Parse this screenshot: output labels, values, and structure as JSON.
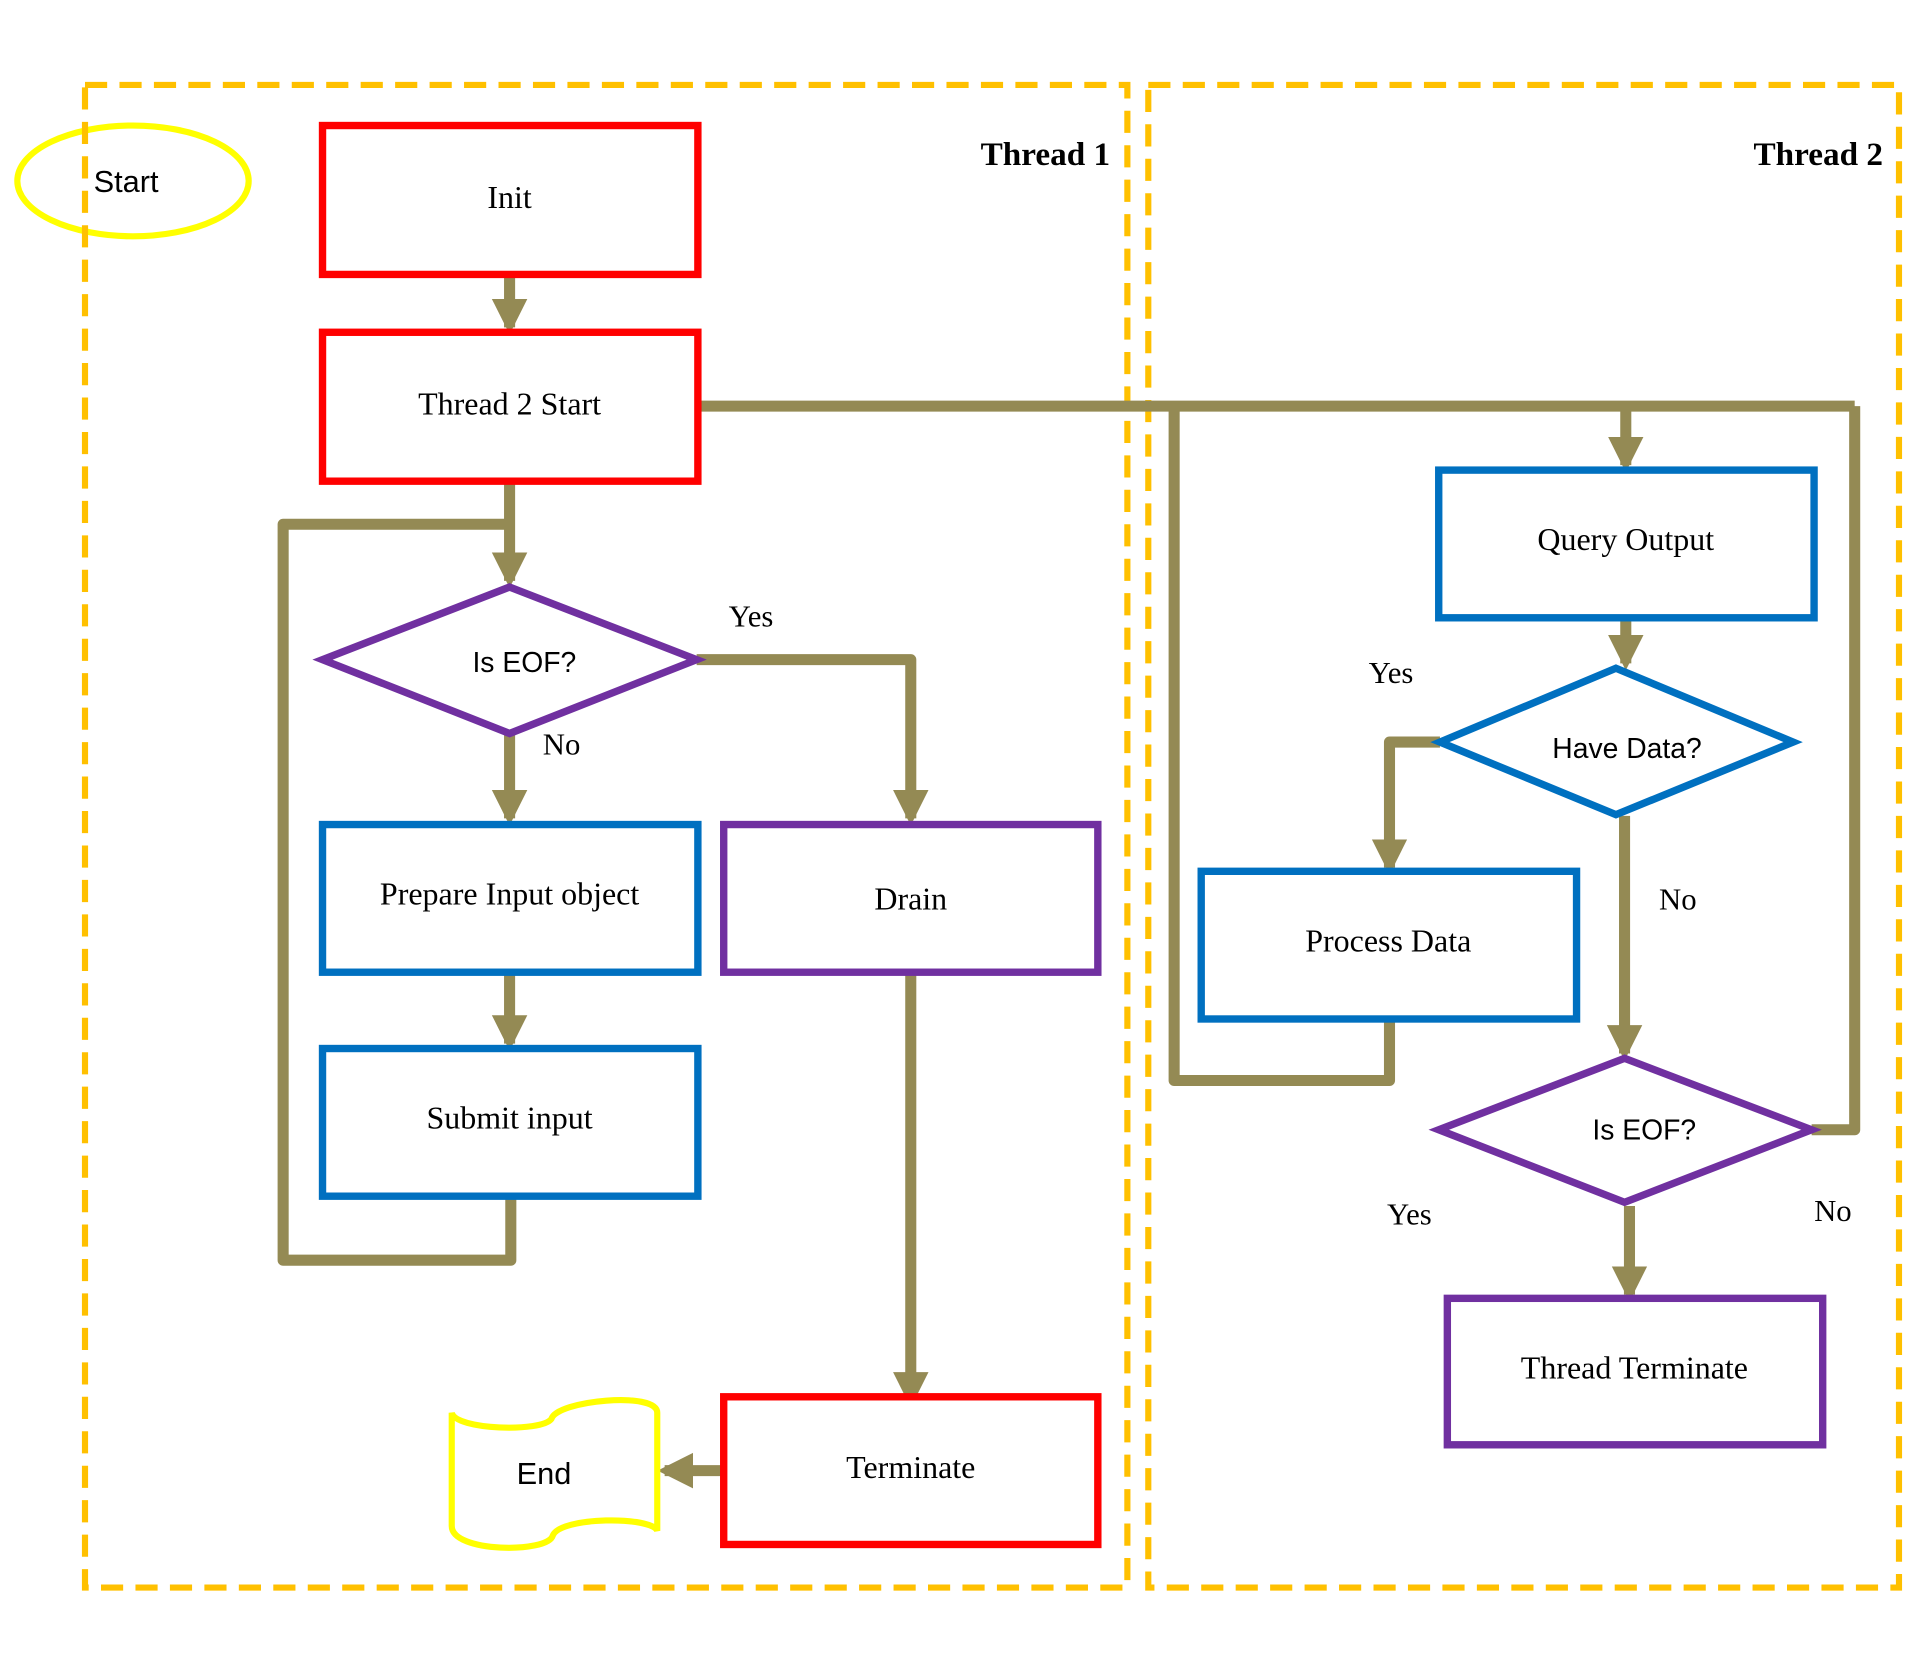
{
  "diagram": {
    "type": "flowchart",
    "colors": {
      "lane_border": "#FFC000",
      "terminator": "#FFFF00",
      "connector": "#948A54",
      "red_box": "#FF0000",
      "blue_box": "#0070C0",
      "purple_box": "#7030A0",
      "text": "#000000"
    },
    "lanes": {
      "thread1": {
        "title": "Thread 1"
      },
      "thread2": {
        "title": "Thread 2"
      }
    },
    "nodes": {
      "start": {
        "label": "Start",
        "shape": "ellipse"
      },
      "init": {
        "label": "Init",
        "shape": "process"
      },
      "thread2_start": {
        "label": "Thread 2 Start",
        "shape": "process"
      },
      "is_eof_1": {
        "label": "Is EOF?",
        "shape": "decision"
      },
      "prepare_input": {
        "label": "Prepare Input object",
        "shape": "process"
      },
      "submit_input": {
        "label": "Submit input",
        "shape": "process"
      },
      "drain": {
        "label": "Drain",
        "shape": "process"
      },
      "terminate": {
        "label": "Terminate",
        "shape": "process"
      },
      "end": {
        "label": "End",
        "shape": "punched-tape"
      },
      "query_output": {
        "label": "Query Output",
        "shape": "process"
      },
      "have_data": {
        "label": "Have Data?",
        "shape": "decision"
      },
      "process_data": {
        "label": "Process Data",
        "shape": "process"
      },
      "is_eof_2": {
        "label": "Is EOF?",
        "shape": "decision"
      },
      "thread_terminate": {
        "label": "Thread Terminate",
        "shape": "process"
      }
    },
    "edge_labels": {
      "eof1_yes": "Yes",
      "eof1_no": "No",
      "have_data_yes": "Yes",
      "have_data_no": "No",
      "eof2_yes": "Yes",
      "eof2_no": "No"
    },
    "edges": [
      {
        "from": "init",
        "to": "thread2_start"
      },
      {
        "from": "thread2_start",
        "to": "is_eof_1"
      },
      {
        "from": "thread2_start",
        "to": "query_output"
      },
      {
        "from": "is_eof_1",
        "to": "drain",
        "label": "Yes"
      },
      {
        "from": "is_eof_1",
        "to": "prepare_input",
        "label": "No"
      },
      {
        "from": "prepare_input",
        "to": "submit_input"
      },
      {
        "from": "submit_input",
        "to": "is_eof_1"
      },
      {
        "from": "drain",
        "to": "terminate"
      },
      {
        "from": "terminate",
        "to": "end"
      },
      {
        "from": "query_output",
        "to": "have_data"
      },
      {
        "from": "have_data",
        "to": "process_data",
        "label": "Yes"
      },
      {
        "from": "have_data",
        "to": "is_eof_2",
        "label": "No"
      },
      {
        "from": "process_data",
        "to": "query_output"
      },
      {
        "from": "is_eof_2",
        "to": "thread_terminate",
        "label": "Yes"
      },
      {
        "from": "is_eof_2",
        "to": "query_output",
        "label": "No"
      }
    ]
  }
}
